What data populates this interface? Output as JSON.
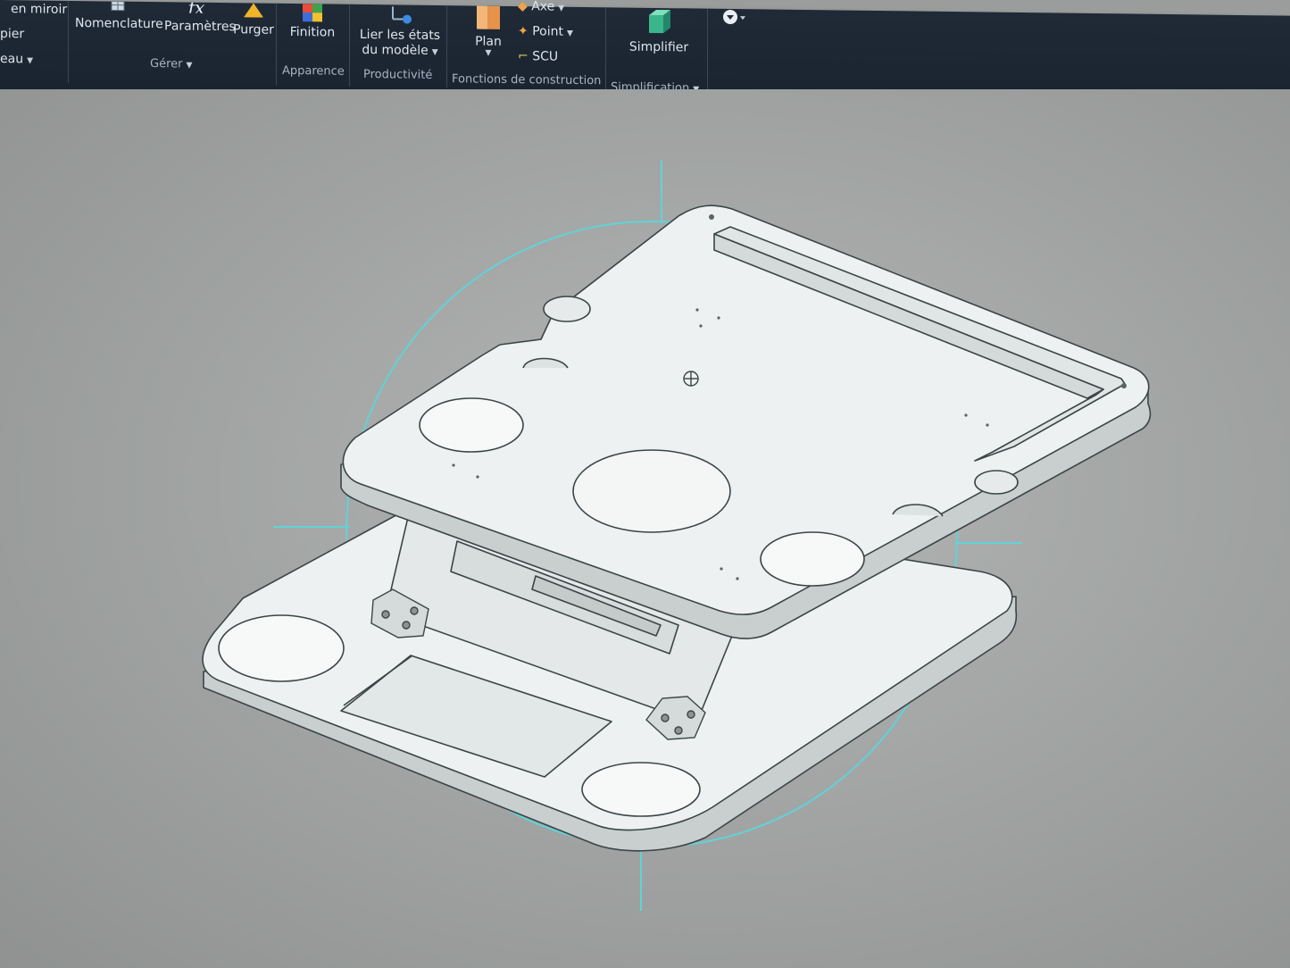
{
  "ribbon": {
    "mirror_label": "en miroir",
    "copy_label": "pier",
    "group_tableau": "eau",
    "nomenclature": "Nomenclature",
    "parametres": "Paramètres",
    "purger": "Purger",
    "group_gerer": "Gérer",
    "finition": "Finition",
    "group_apparence": "Apparence",
    "lier_line1": "Lier les états",
    "lier_line2": "du modèle",
    "group_productivite": "Productivité",
    "plan": "Plan",
    "axe": "Axe",
    "point": "Point",
    "scu": "SCU",
    "group_fonctions": "Fonctions de construction",
    "simplifier": "Simplifier",
    "group_simplification": "Simplification"
  },
  "icons": {
    "nomenclature": "table-icon",
    "parametres": "fx-icon",
    "purger": "purge-triangle-icon",
    "finition": "appearance-cube-icon",
    "lier": "link-states-icon",
    "plan": "work-plane-icon",
    "axe": "work-axis-icon",
    "point": "work-point-icon",
    "scu": "ucs-icon",
    "simplifier": "simplify-icon",
    "quick": "dropdown-circle-icon"
  },
  "colors": {
    "ribbon_bg": "#1f2a36",
    "viewport_bg": "#a3a6a5",
    "part_fill": "#eef1f1",
    "part_edge": "#3c4446",
    "orbit_cyan": "#62d2d8"
  }
}
